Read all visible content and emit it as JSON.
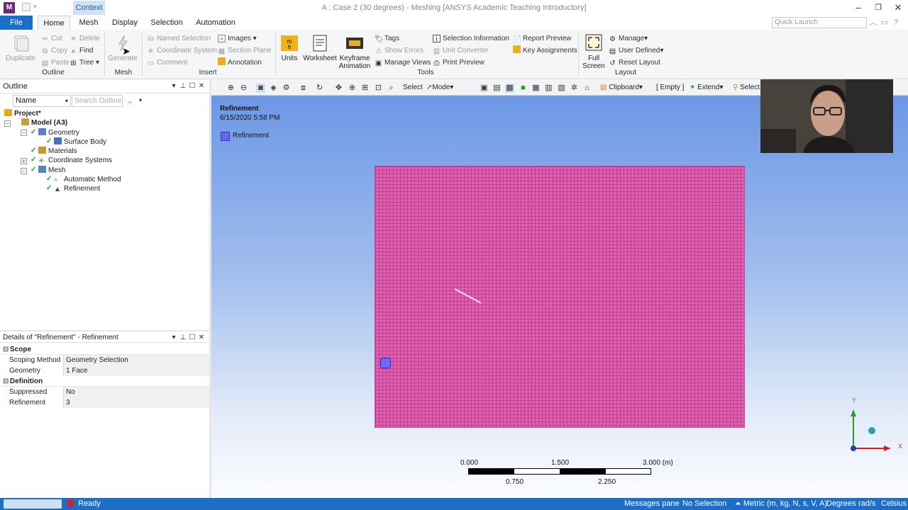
{
  "window": {
    "title": "A : Case 2 (30 degrees) - Meshing [ANSYS Academic Teaching Introductory]",
    "context_tab": "Context",
    "quick_launch_placeholder": "Quick Launch"
  },
  "ribbon_tabs": [
    "File",
    "Home",
    "Mesh",
    "Display",
    "Selection",
    "Automation"
  ],
  "ribbon": {
    "outline": {
      "label": "Outline",
      "duplicate": "Duplicate",
      "cut": "Cut",
      "copy": "Copy",
      "paste": "Paste",
      "delete": "Delete",
      "find": "Find",
      "tree": "Tree"
    },
    "mesh": {
      "label": "Mesh",
      "generate": "Generate"
    },
    "insert": {
      "label": "Insert",
      "named_selection": "Named Selection",
      "coordinate_system": "Coordinate System",
      "comment": "Comment",
      "images": "Images",
      "section_plane": "Section Plane",
      "annotation": "Annotation"
    },
    "tools": {
      "label": "Tools",
      "units": "Units",
      "worksheet": "Worksheet",
      "keyframe_line1": "Keyframe",
      "keyframe_line2": "Animation",
      "tags": "Tags",
      "show_errors": "Show Errors",
      "manage_views": "Manage Views",
      "selection_information": "Selection Information",
      "unit_converter": "Unit Converter",
      "print_preview": "Print Preview",
      "report_preview": "Report Preview",
      "key_assignments": "Key Assignments"
    },
    "layout": {
      "label": "Layout",
      "full_line1": "Full",
      "full_line2": "Screen",
      "manage": "Manage",
      "user_defined": "User Defined",
      "reset_layout": "Reset Layout"
    }
  },
  "outline": {
    "title": "Outline",
    "name_combo": "Name",
    "search_placeholder": "Search Outline",
    "tree": {
      "project": "Project*",
      "model": "Model (A3)",
      "geometry": "Geometry",
      "surface_body": "Surface Body",
      "materials": "Materials",
      "coordinate_systems": "Coordinate Systems",
      "mesh": "Mesh",
      "automatic_method": "Automatic Method",
      "refinement": "Refinement"
    }
  },
  "details": {
    "title": "Details of \"Refinement\" - Refinement",
    "scope": "Scope",
    "scoping_method_k": "Scoping Method",
    "scoping_method_v": "Geometry Selection",
    "geometry_k": "Geometry",
    "geometry_v": "1 Face",
    "definition": "Definition",
    "suppressed_k": "Suppressed",
    "suppressed_v": "No",
    "refinement_k": "Refinement",
    "refinement_v": "3"
  },
  "graphics_toolbar": {
    "select": "Select",
    "mode": "Mode",
    "clipboard": "Clipboard",
    "empty": "[ Empty ]",
    "extend": "Extend",
    "select_right": "Select"
  },
  "viewport": {
    "object_title": "Refinement",
    "date": "6/15/2020 5:58 PM",
    "legend_label": "Refinement",
    "scale_top": [
      "0.000",
      "1.500",
      "3.000 (m)"
    ],
    "scale_bottom": [
      "0.750",
      "2.250"
    ],
    "axis_y": "Y",
    "axis_x": "X"
  },
  "status": {
    "ready": "Ready",
    "messages": "Messages pane",
    "selection": "No Selection",
    "units": "Metric (m, kg, N, s, V, A)",
    "angle": "Degrees",
    "rate": "rad/s",
    "temp": "Celsius"
  },
  "colors": {
    "accent": "#1a6fc9",
    "mesh": "#e060b0",
    "refinement": "#6a6aff"
  }
}
